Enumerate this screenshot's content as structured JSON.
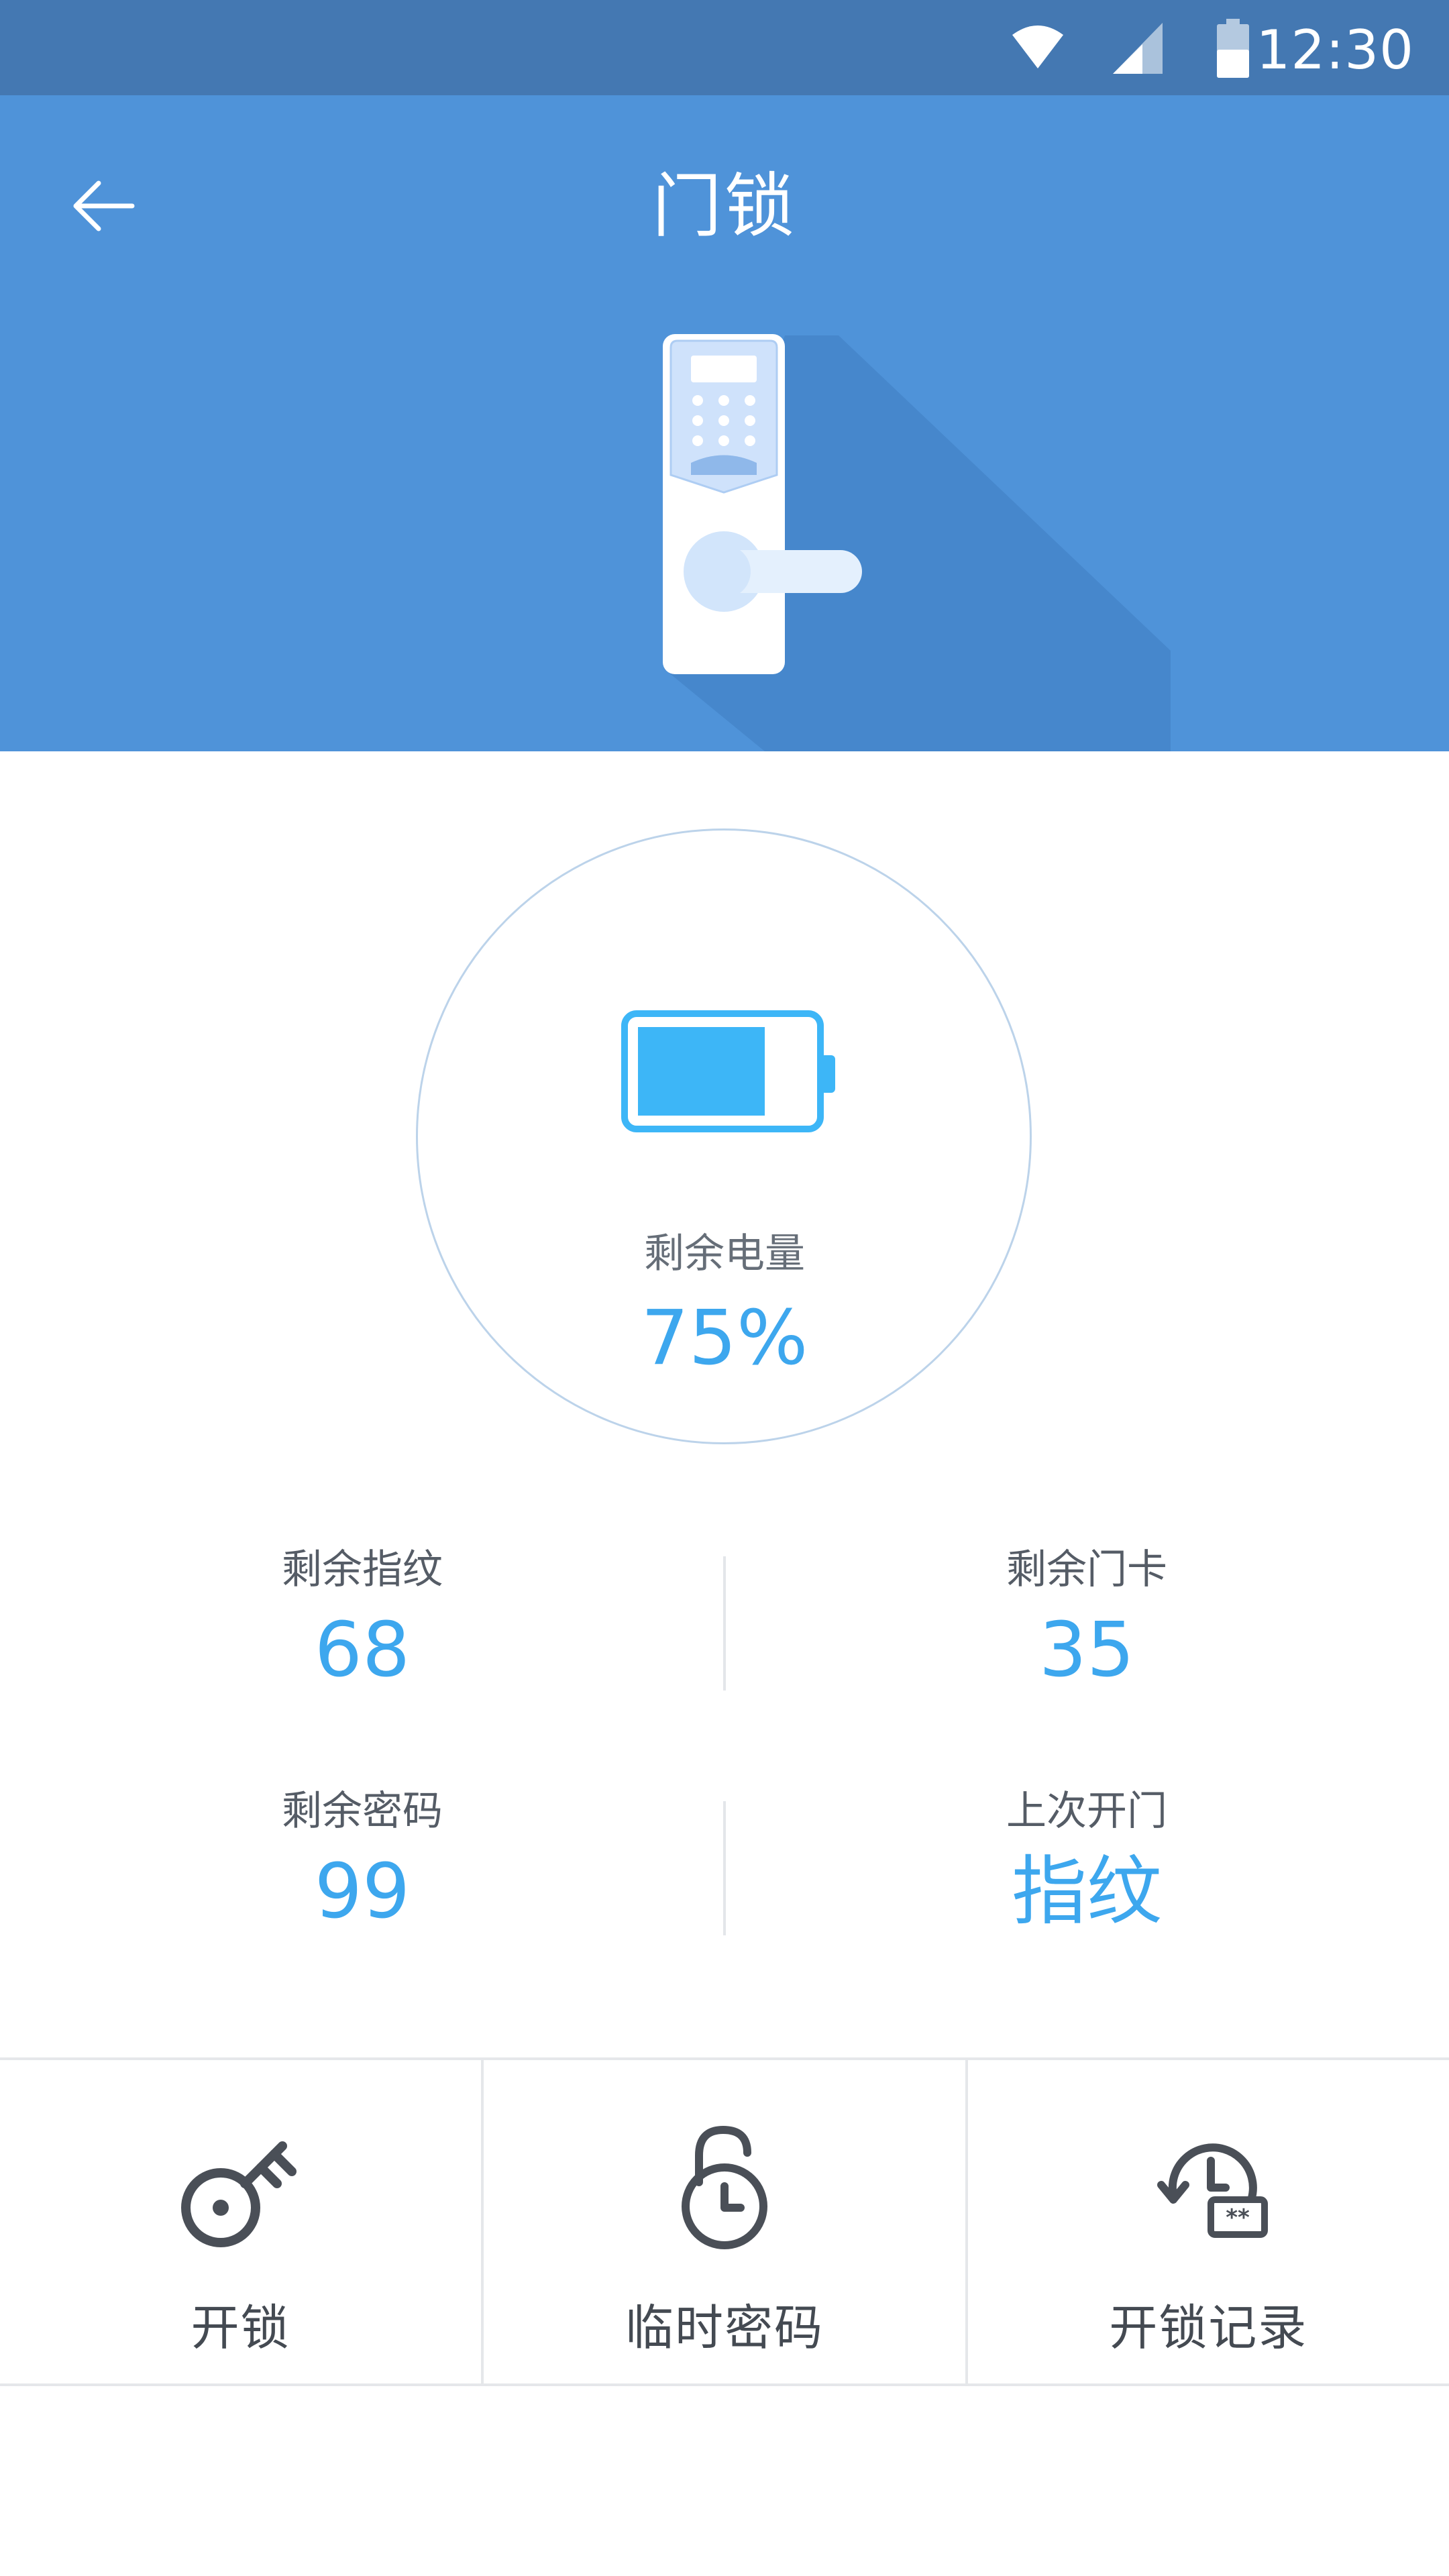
{
  "status_bar": {
    "time": "12:30"
  },
  "header": {
    "title": "门锁",
    "back_icon": "arrow-left-icon"
  },
  "battery": {
    "label": "剩余电量",
    "value": "75%",
    "level": 0.75,
    "color": "#3db6f7"
  },
  "stats": [
    {
      "label": "剩余指纹",
      "value": "68"
    },
    {
      "label": "剩余门卡",
      "value": "35"
    },
    {
      "label": "剩余密码",
      "value": "99"
    },
    {
      "label": "上次开门",
      "value": "指纹"
    }
  ],
  "actions": [
    {
      "label": "开锁",
      "icon": "key-icon"
    },
    {
      "label": "临时密码",
      "icon": "timed-lock-icon"
    },
    {
      "label": "开锁记录",
      "icon": "unlock-history-icon"
    }
  ],
  "colors": {
    "header_bg": "#4f93d9",
    "status_bg": "#4478b2",
    "accent": "#3da7ee"
  }
}
